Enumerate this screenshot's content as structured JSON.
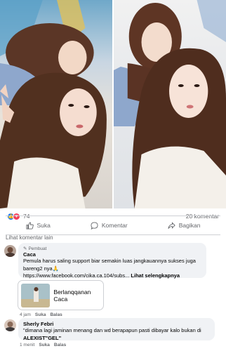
{
  "stats": {
    "reaction_count": "74",
    "comment_count": "20 komentar"
  },
  "actions": {
    "like": "Suka",
    "comment": "Komentar",
    "share": "Bagikan"
  },
  "more_comments": "Lihat komentar lain",
  "comments": [
    {
      "badge": "Pembuat",
      "author": "Caca",
      "text": "Pemula harus saling support biar semakin luas jangkauannya sukses juga bareng2 nya🙏",
      "link_text": "https://www.facebook.com/cika.ca.104/subs...",
      "see_more": "Lihat selengkapnya",
      "card_title": "Berlanqqanan Caca",
      "time": "4 jam",
      "like": "Suka",
      "reply": "Balas"
    },
    {
      "author": "Sherly Febri",
      "text_line1": "\"dimana lagi jaminan menang dan wd berapapun pasti dibayar kalo bukan di",
      "text_line2": "ALEXIST\"GEL\"",
      "time": "1 menit",
      "like": "Suka",
      "reply": "Balas"
    }
  ],
  "colors": {
    "facebook_blue": "#1877f2",
    "love_red": "#f33e58",
    "bubble_gray": "#f0f2f5",
    "hijab_brown": "#5a3324"
  }
}
